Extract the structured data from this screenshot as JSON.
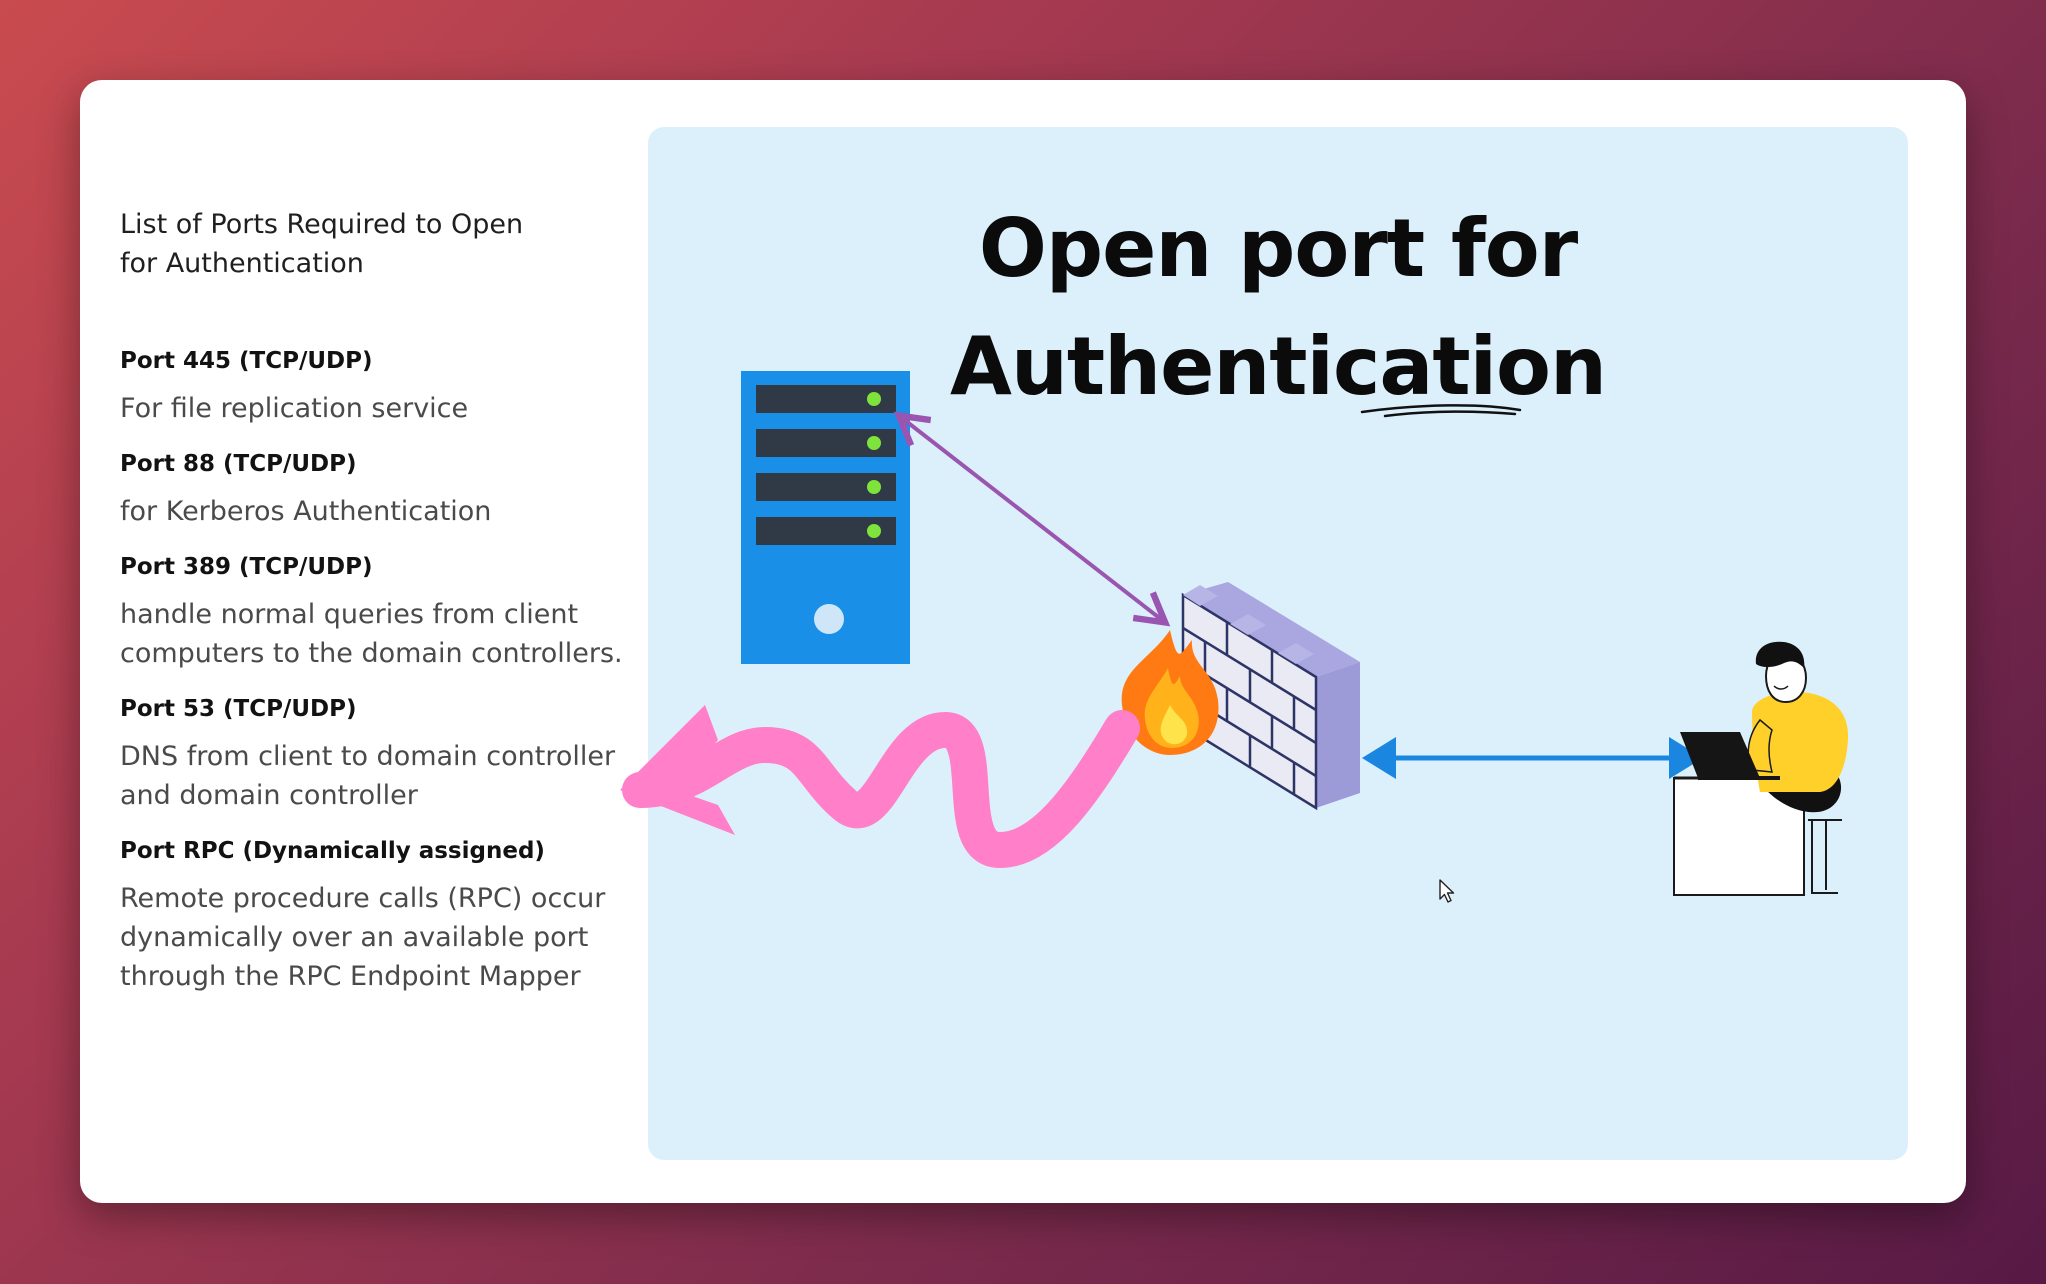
{
  "list": {
    "title": "List of Ports Required to Open\nfor Authentication",
    "ports": [
      {
        "name": "Port 445 (TCP/UDP)",
        "desc": "For file replication service"
      },
      {
        "name": "Port 88 (TCP/UDP)",
        "desc": "for Kerberos Authentication"
      },
      {
        "name": "Port 389 (TCP/UDP)",
        "desc": "handle normal queries from client computers to the domain controllers."
      },
      {
        "name": "Port 53 (TCP/UDP)",
        "desc": "DNS from client to domain controller and domain controller"
      },
      {
        "name": "Port RPC (Dynamically assigned)",
        "desc": "Remote procedure calls (RPC) occur dynamically over an available port through the RPC Endpoint Mapper"
      }
    ]
  },
  "diagram": {
    "title_line1": "Open port for",
    "title_line2": "Authentication",
    "icons": [
      "server-icon",
      "firewall-icon",
      "fire-icon",
      "user-at-laptop-icon",
      "cursor-icon"
    ],
    "colors": {
      "background": "#dcf0fc",
      "server": "#1a8fe8",
      "purple_arrow": "#9a55b0",
      "pink_arrow": "#ff7fc8",
      "blue_arrow": "#1a86e0",
      "person_shirt": "#ffd02a"
    }
  }
}
